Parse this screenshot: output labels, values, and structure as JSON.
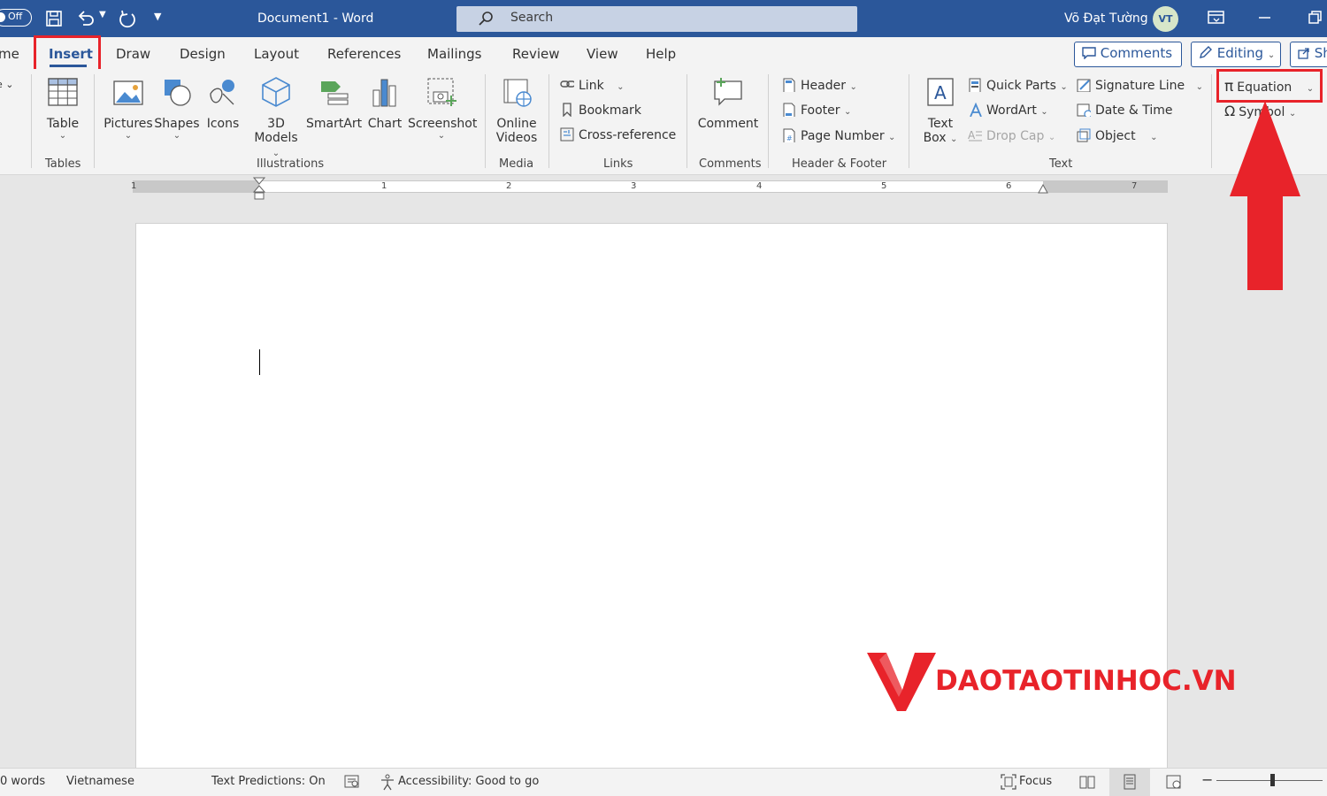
{
  "titlebar": {
    "autosave": "Off",
    "doc_title": "Document1  -  Word",
    "search_placeholder": "Search",
    "user_name": "Võ Đạt Tường",
    "avatar_initials": "VT"
  },
  "tabs": [
    {
      "label": "me"
    },
    {
      "label": "Insert"
    },
    {
      "label": "Draw"
    },
    {
      "label": "Design"
    },
    {
      "label": "Layout"
    },
    {
      "label": "References"
    },
    {
      "label": "Mailings"
    },
    {
      "label": "Review"
    },
    {
      "label": "View"
    },
    {
      "label": "Help"
    }
  ],
  "top_buttons": {
    "comments": "Comments",
    "editing": "Editing",
    "share": "Sh"
  },
  "ribbon": {
    "tables": {
      "group": "Tables",
      "table": "Table"
    },
    "illustrations": {
      "group": "Illustrations",
      "pictures": "Pictures",
      "shapes": "Shapes",
      "icons": "Icons",
      "models_line1": "3D",
      "models_line2": "Models",
      "smartart": "SmartArt",
      "chart": "Chart",
      "screenshot": "Screenshot"
    },
    "media": {
      "group": "Media",
      "online_line1": "Online",
      "online_line2": "Videos"
    },
    "links": {
      "group": "Links",
      "link": "Link",
      "bookmark": "Bookmark",
      "crossref": "Cross-reference"
    },
    "comments": {
      "group": "Comments",
      "comment": "Comment"
    },
    "headerfooter": {
      "group": "Header & Footer",
      "header": "Header",
      "footer": "Footer",
      "page_number": "Page Number"
    },
    "text": {
      "group": "Text",
      "textbox_line1": "Text",
      "textbox_line2": "Box",
      "quick_parts": "Quick Parts",
      "wordart": "WordArt",
      "drop_cap": "Drop Cap",
      "signature_line": "Signature Line",
      "date_time": "Date & Time",
      "object": "Object"
    },
    "symbols": {
      "equation": "Equation",
      "symbol": "Symbol"
    }
  },
  "ruler": {
    "numbers": [
      "1",
      "1",
      "2",
      "3",
      "4",
      "5",
      "6",
      "7"
    ]
  },
  "status": {
    "words": "0 words",
    "language": "Vietnamese",
    "predictions": "Text Predictions: On",
    "accessibility": "Accessibility: Good to go",
    "focus": "Focus"
  },
  "watermark": {
    "text": "DAOTAOTINHOC.VN"
  },
  "colors": {
    "title_bar": "#2b579a",
    "highlight_red": "#e8232a",
    "ribbon_bg": "#f3f3f3"
  }
}
